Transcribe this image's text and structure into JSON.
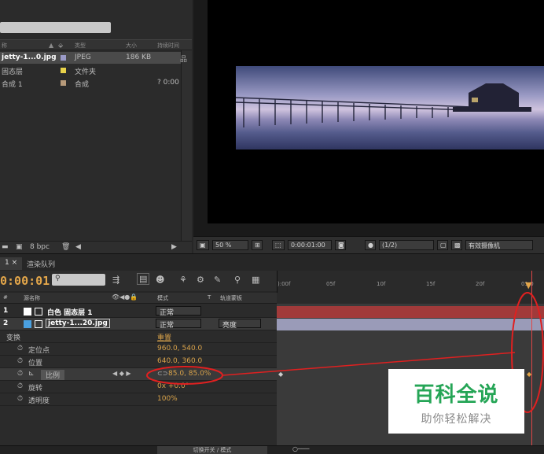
{
  "project": {
    "columns": {
      "name": "称",
      "type": "类型",
      "size": "大小",
      "duration": "持续时间"
    },
    "items": [
      {
        "name": "jetty-1...0.jpg",
        "type": "JPEG",
        "size": "186 KB",
        "duration": "",
        "color": "#9b9bc8"
      },
      {
        "name": "固态层",
        "type": "文件夹",
        "size": "",
        "duration": "",
        "color": "#e8d24a"
      },
      {
        "name": "合成 1",
        "type": "合成",
        "size": "",
        "duration": "? 0:00",
        "color": "#b79a7a"
      }
    ],
    "bpc": "8 bpc"
  },
  "comp_viewer": {
    "zoom": "50 %",
    "timecode": "0:00:01:00",
    "resolution": "(1/2)",
    "camera": "有效摄像机"
  },
  "tabs": [
    {
      "label": "1 ×"
    },
    {
      "label": "渲染队列"
    }
  ],
  "timeline": {
    "timecode": "0:00:01:00",
    "ruler_ticks": [
      "):00f",
      "05f",
      "10f",
      "15f",
      "20f",
      "01:0"
    ],
    "headers": {
      "num": "#",
      "source": "源名称",
      "mode": "模式",
      "t": "T",
      "trkmat": "轨道蒙板"
    },
    "layers": [
      {
        "num": "1",
        "name": "白色 固态层 1",
        "mode": "正常",
        "trkmat": ""
      },
      {
        "num": "2",
        "name": "jetty-1...20.jpg",
        "mode": "正常",
        "trkmat": "亮度"
      }
    ],
    "transform": {
      "label": "变换",
      "reset": "重置",
      "properties": [
        {
          "name": "定位点",
          "value": "960.0, 540.0"
        },
        {
          "name": "位置",
          "value": "640.0, 360.0"
        },
        {
          "name": "比例",
          "value": "85.0, 85.0%"
        },
        {
          "name": "旋转",
          "value": "0x +0.0°"
        },
        {
          "name": "透明度",
          "value": "100%"
        }
      ]
    },
    "footer_label": "切换开关 / 模式"
  },
  "watermark": {
    "title": "百科全说",
    "subtitle": "助你轻松解决"
  },
  "colors": {
    "timecode": "#e3a64a",
    "layer1_bar": "#a13a3a",
    "layer2_bar": "#9a9bb8",
    "annotation": "#e02020"
  }
}
